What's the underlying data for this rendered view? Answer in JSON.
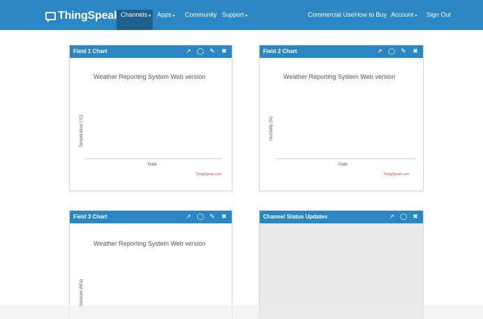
{
  "navbar": {
    "brand": "ThingSpeak",
    "brand_tm": "™",
    "menu": {
      "channels": "Channels",
      "apps": "Apps",
      "community": "Community",
      "support": "Support"
    },
    "right": {
      "commercial": "Commercial Use",
      "how_to_buy": "How to Buy",
      "account": "Account",
      "sign_out": "Sign Out"
    },
    "caret": "▾"
  },
  "panels": {
    "field1": {
      "title": "Field 1 Chart",
      "chart_title": "Weather Reporting System Web version",
      "ylabel": "Temperature (°C)",
      "xlabel": "Date",
      "credit": "ThingSpeak.com"
    },
    "field2": {
      "title": "Field 2 Chart",
      "chart_title": "Weather Reporting System Web version",
      "ylabel": "Humidity (%)",
      "xlabel": "Date",
      "credit": "ThingSpeak.com"
    },
    "field3": {
      "title": "Field 3 Chart",
      "chart_title": "Weather Reporting System Web version",
      "ylabel": "Pressure (hPa)"
    },
    "status": {
      "title": "Channel Status Updates"
    }
  },
  "icons": {
    "external": "↗",
    "comment": "◯",
    "edit": "✎",
    "close": "✖"
  }
}
